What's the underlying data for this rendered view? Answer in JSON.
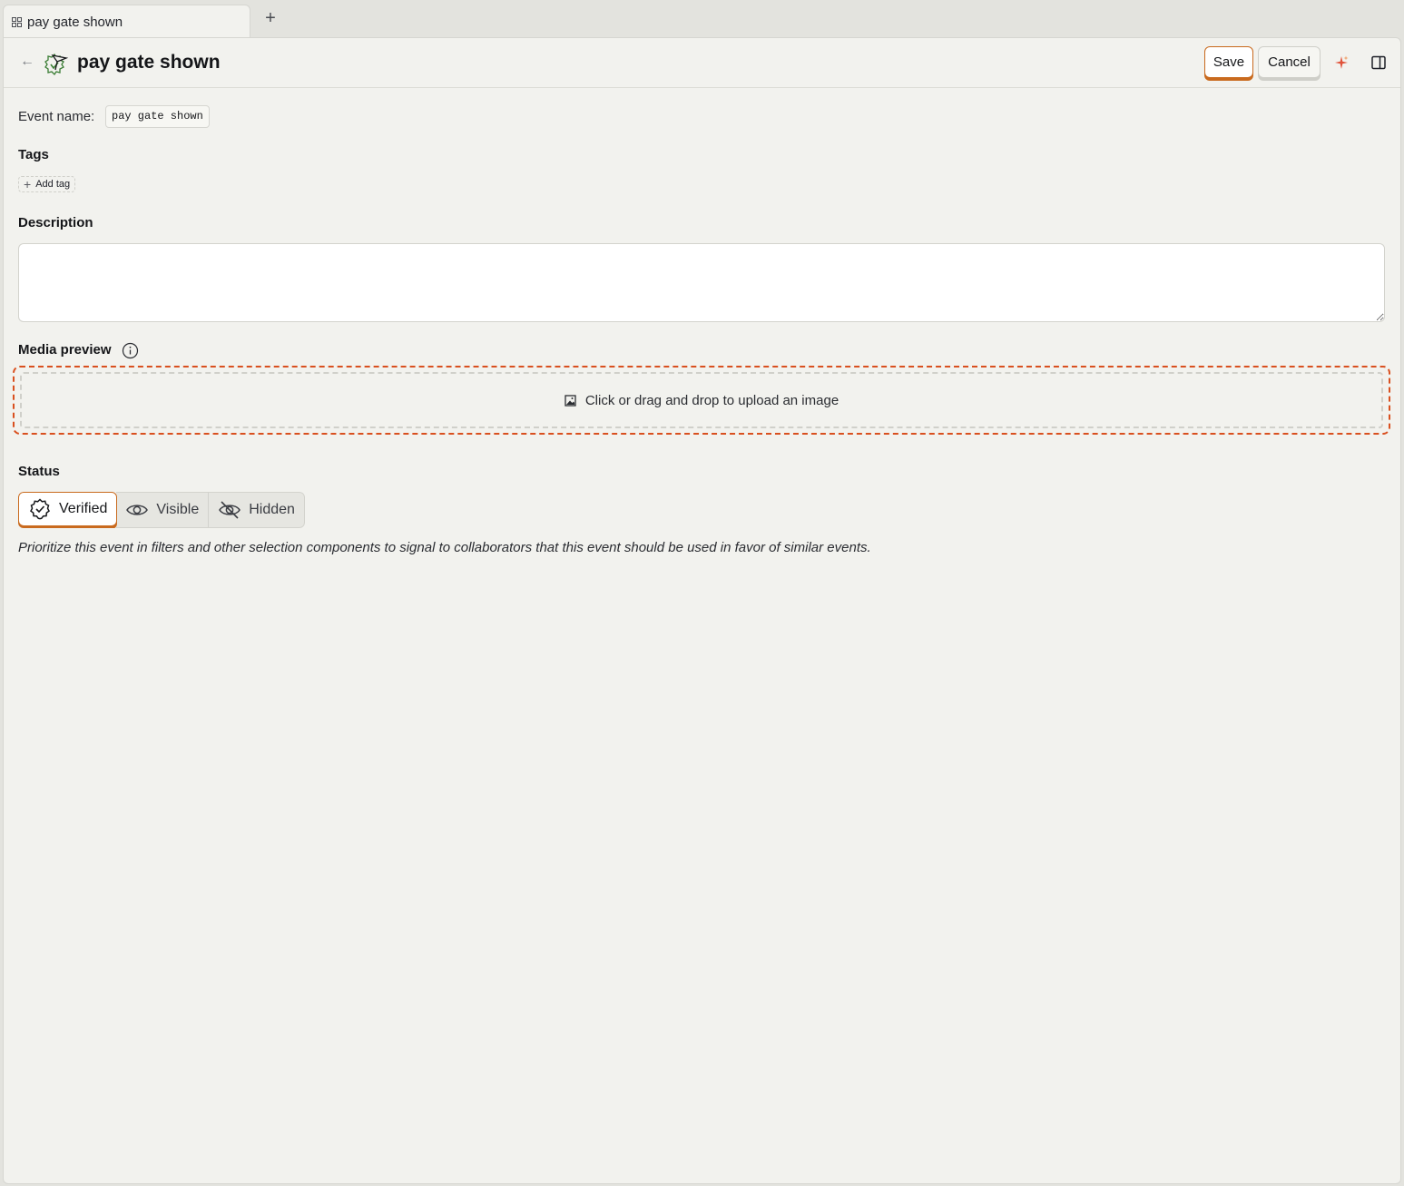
{
  "tabs": [
    {
      "label": "pay gate shown",
      "icon": "grid-icon"
    }
  ],
  "new_tab_icon": "+",
  "header": {
    "back_icon": "←",
    "title": "pay gate shown",
    "save_label": "Save",
    "cancel_label": "Cancel"
  },
  "event_name": {
    "label": "Event name:",
    "value": "pay gate shown"
  },
  "tags": {
    "label": "Tags",
    "add_label": "Add tag"
  },
  "description": {
    "label": "Description",
    "value": "",
    "placeholder": ""
  },
  "media": {
    "label": "Media preview",
    "upload_text": "Click or drag and drop to upload an image"
  },
  "status": {
    "label": "Status",
    "options": [
      {
        "label": "Verified",
        "selected": true
      },
      {
        "label": "Visible",
        "selected": false
      },
      {
        "label": "Hidden",
        "selected": false
      }
    ],
    "help_text": "Prioritize this event in filters and other selection components to signal to collaborators that this event should be used in favor of similar events."
  },
  "colors": {
    "accent": "#c96a1e",
    "upload_border": "#d9501f",
    "background": "#f2f2ee"
  }
}
